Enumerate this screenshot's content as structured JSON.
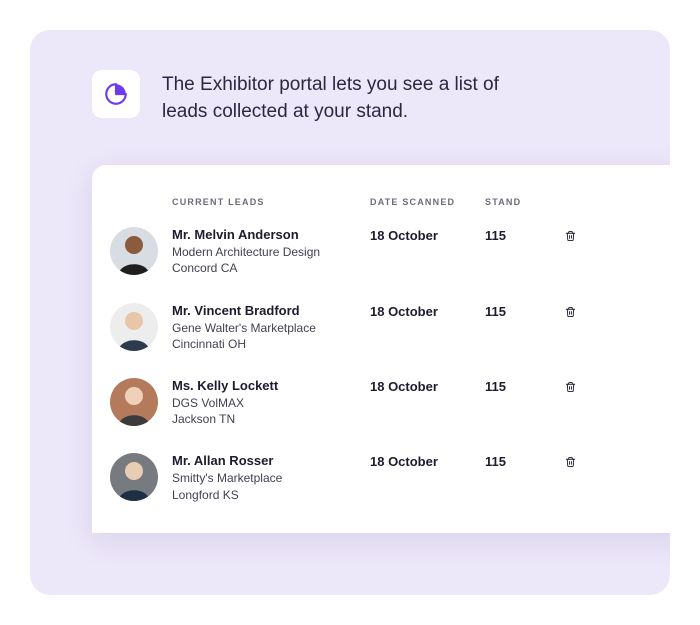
{
  "hero": {
    "text": "The Exhibitor portal lets you see a list of leads collected at your stand.",
    "icon": "pie-chart-icon"
  },
  "columns": {
    "leads": "CURRENT LEADS",
    "date": "DATE SCANNED",
    "stand": "STAND"
  },
  "colors": {
    "accent": "#6D3BEB"
  },
  "leads": [
    {
      "name": "Mr. Melvin Anderson",
      "company": "Modern Architecture Design",
      "location": "Concord CA",
      "date_scanned": "18 October",
      "stand": "115",
      "avatar_bg": "#D8DDE4"
    },
    {
      "name": "Mr. Vincent Bradford",
      "company": "Gene Walter's Marketplace",
      "location": "Cincinnati OH",
      "date_scanned": "18 October",
      "stand": "115",
      "avatar_bg": "#EDEDED"
    },
    {
      "name": "Ms. Kelly Lockett",
      "company": "DGS VolMAX",
      "location": "Jackson TN",
      "date_scanned": "18 October",
      "stand": "115",
      "avatar_bg": "#B47A5C"
    },
    {
      "name": "Mr. Allan Rosser",
      "company": "Smitty's Marketplace",
      "location": "Longford KS",
      "date_scanned": "18 October",
      "stand": "115",
      "avatar_bg": "#777A7E"
    }
  ]
}
